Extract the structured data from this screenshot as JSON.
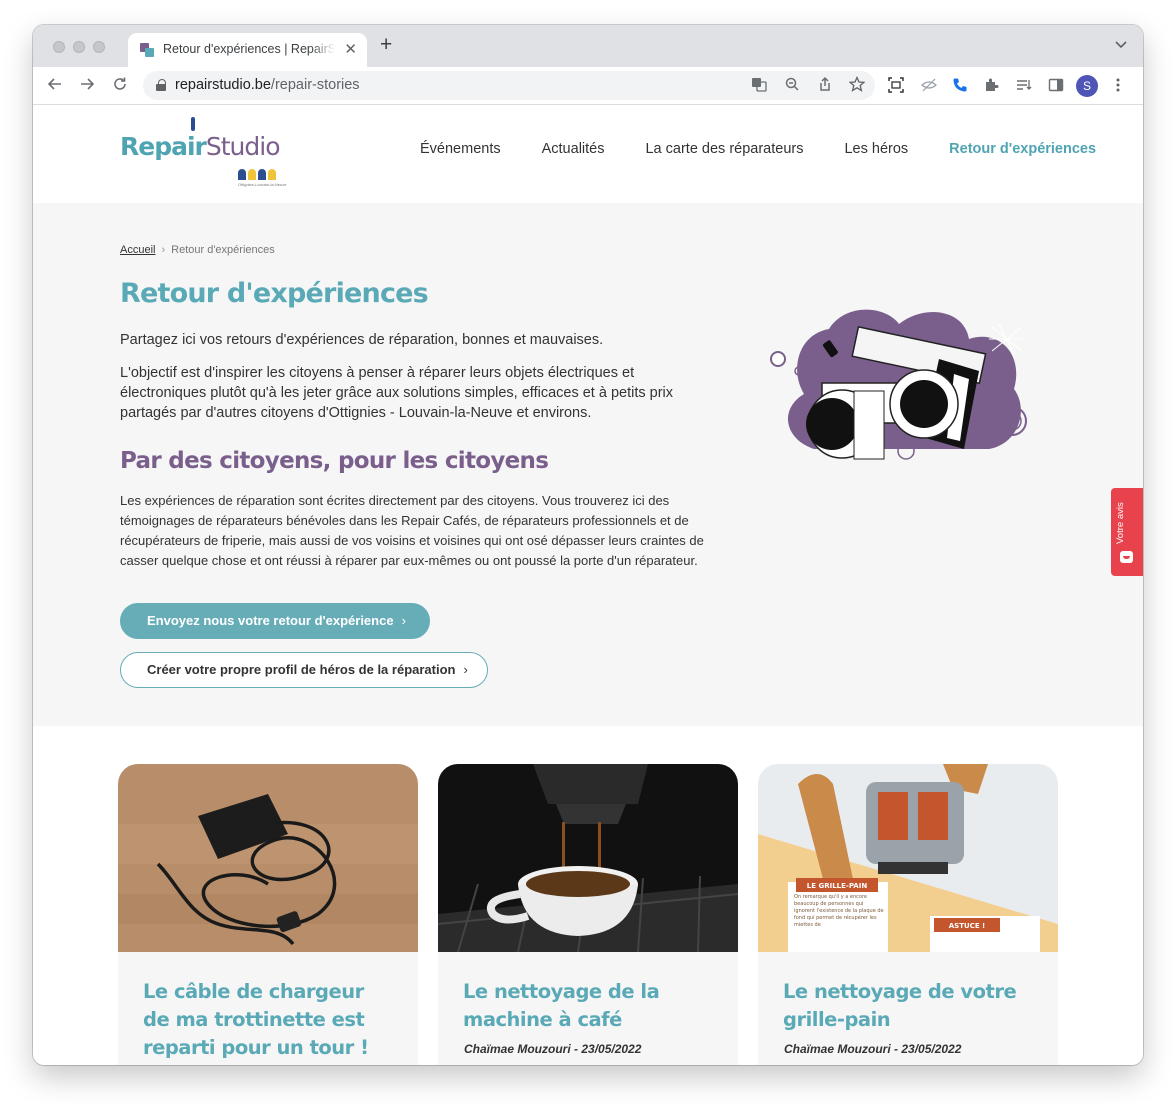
{
  "browser": {
    "tab_title": "Retour d'expériences | RepairStudio",
    "url_host": "repairstudio.be",
    "url_path": "/repair-stories",
    "new_tab_symbol": "+",
    "tab_close_symbol": "✕",
    "profile_initial": "S",
    "icons": [
      "back-icon",
      "forward-icon",
      "reload-icon",
      "lock-icon",
      "translate-icon",
      "zoom-icon",
      "share-icon",
      "bookmark-star-icon",
      "screen-capture-icon",
      "eye-off-icon",
      "phone-icon",
      "extensions-icon",
      "reading-list-icon",
      "side-panel-icon",
      "menu-kebab-icon"
    ]
  },
  "site": {
    "logo": {
      "part1": "Repair",
      "part2": "Studio",
      "sub": "Ottignies-Louvain-la-Neuve"
    },
    "nav": [
      "Événements",
      "Actualités",
      "La carte des réparateurs",
      "Les héros",
      "Retour d'expériences"
    ],
    "active_nav": "Retour d'expériences"
  },
  "hero": {
    "breadcrumb_home": "Accueil",
    "breadcrumb_sep": "›",
    "breadcrumb_current": "Retour d'expériences",
    "title": "Retour d'expériences",
    "lead": "Partagez ici vos retours d'expériences de réparation, bonnes et mauvaises.",
    "body": "L'objectif est d'inspirer les citoyens à penser à réparer leurs objets électriques et électroniques plutôt qu'à les jeter grâce aux solutions simples, efficaces et à petits prix partagés par d'autres citoyens d'Ottignies - Louvain-la-Neuve et environs.",
    "subtitle": "Par des citoyens, pour les citoyens",
    "description": "Les expériences de réparation sont écrites directement par des citoyens. Vous trouverez ici des témoignages de réparateurs bénévoles dans les Repair Cafés, de réparateurs professionnels et de récupérateurs de friperie, mais aussi de vos voisins et voisines qui ont osé dépasser leurs craintes de casser quelque chose et ont réussi à réparer par eux-mêmes ou ont poussé la porte d'un réparateur.",
    "cta_primary": "Envoyez nous votre retour d'expérience",
    "cta_secondary": "Créer votre propre profil de héros de la réparation",
    "chevron": "›"
  },
  "feedback": {
    "label": "Votre avis"
  },
  "cards": [
    {
      "title": "Le câble de chargeur de ma trottinette est reparti pour un tour !",
      "meta": ""
    },
    {
      "title": "Le nettoyage de la machine à café",
      "meta": "Chaïmae Mouzouri - 23/05/2022"
    },
    {
      "title": "Le nettoyage de votre grille-pain",
      "meta": "Chaïmae Mouzouri - 23/05/2022",
      "image_texts": {
        "label": "LE GRILLE-PAIN",
        "tip": "ASTUCE !",
        "note": "On remarque qu'il y a encore beaucoup de personnes qui ignorent l'existence de la plaque de fond qui permet de récupérer les miettes de"
      }
    }
  ],
  "colors": {
    "teal": "#5aa9b6",
    "purple": "#7a5f8c",
    "button": "#66adb8",
    "feedback_red": "#e8424c",
    "hero_bg": "#f6f6f6"
  }
}
